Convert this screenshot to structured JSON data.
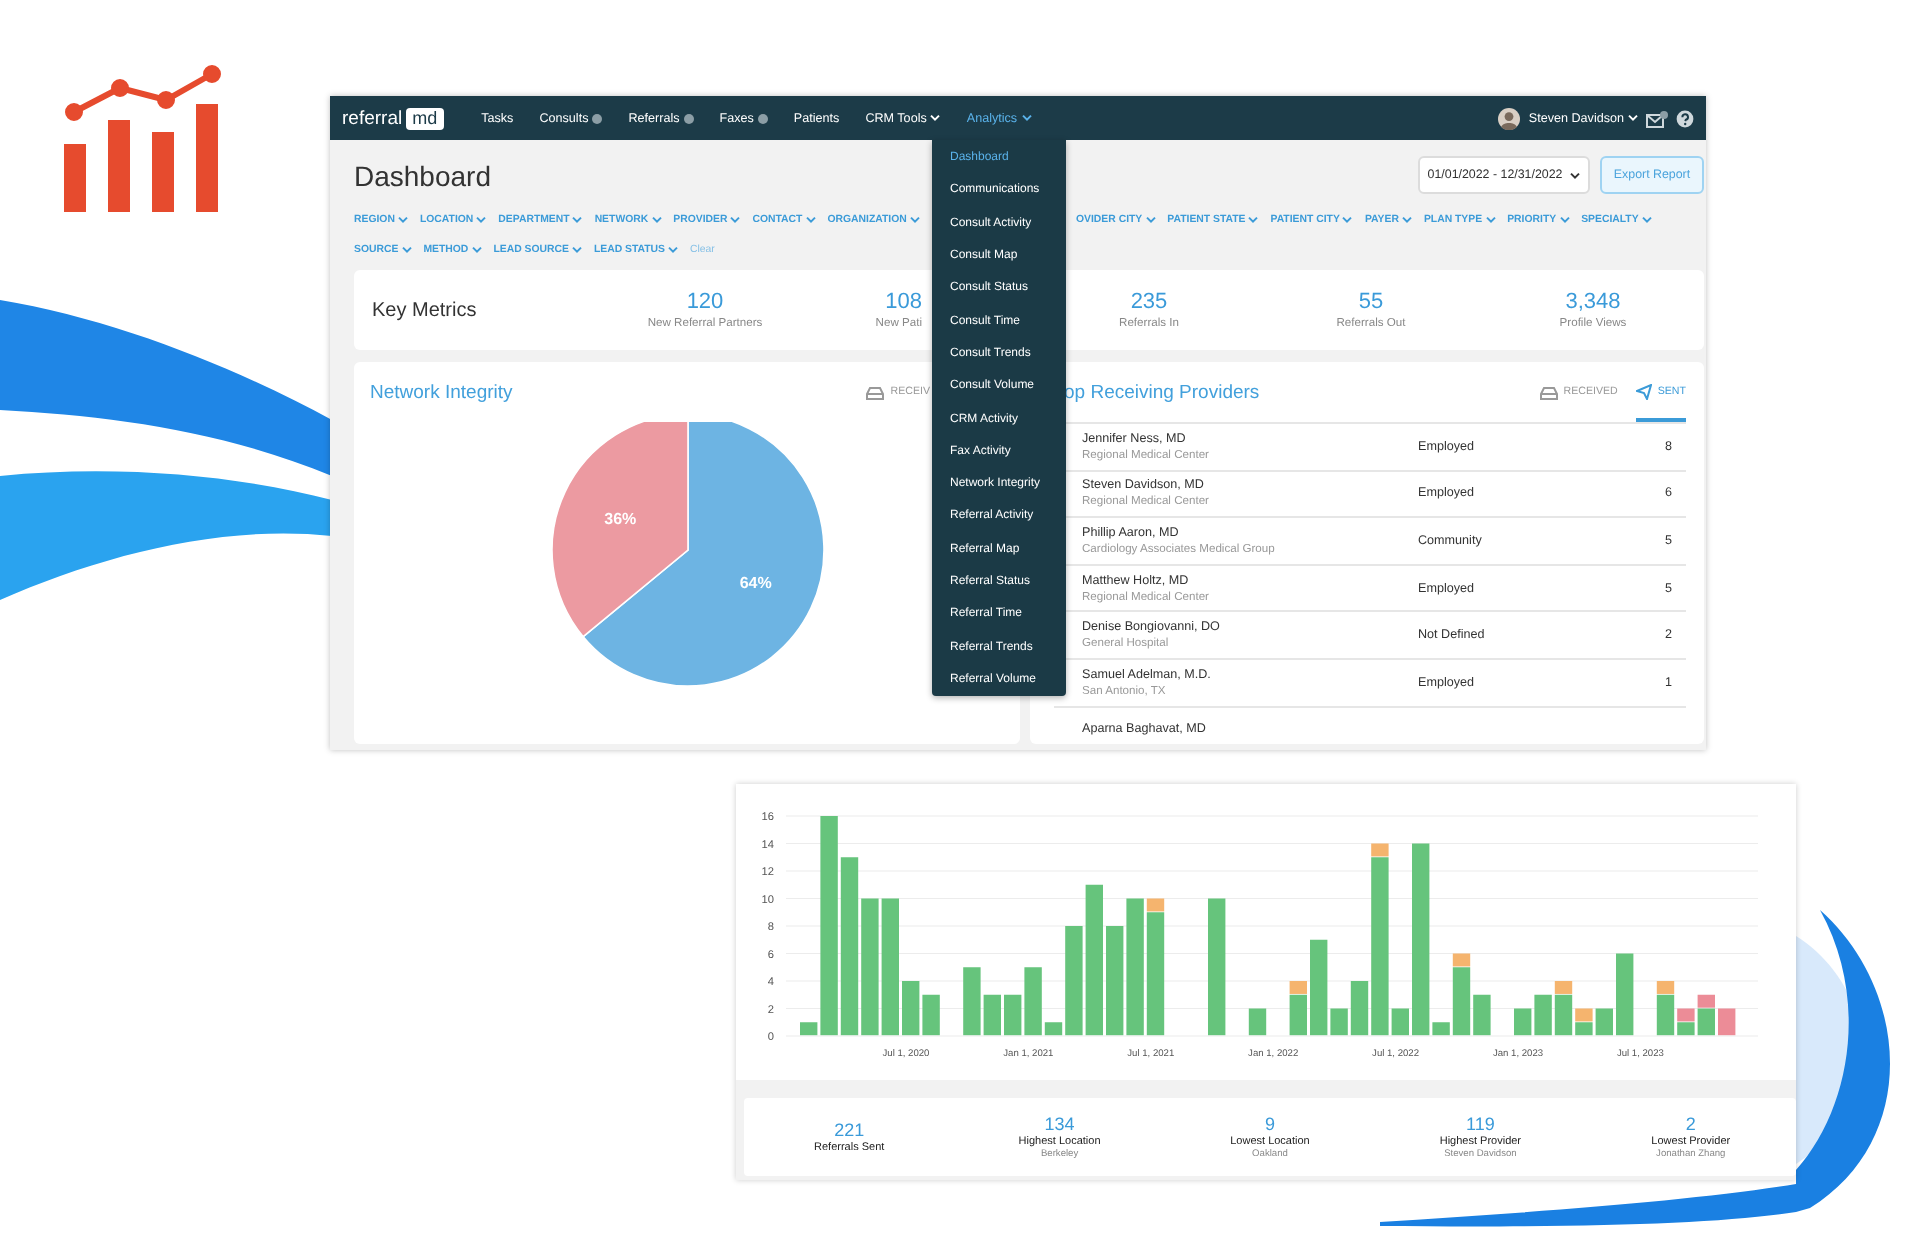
{
  "navbar": {
    "brand": "referral",
    "brand_badge": "md",
    "items": [
      {
        "label": "Tasks",
        "badge": false,
        "dropdown": false,
        "selected": false
      },
      {
        "label": "Consults",
        "badge": true,
        "dropdown": false,
        "selected": false
      },
      {
        "label": "Referrals",
        "badge": true,
        "dropdown": false,
        "selected": false
      },
      {
        "label": "Faxes",
        "badge": true,
        "dropdown": false,
        "selected": false
      },
      {
        "label": "Patients",
        "badge": false,
        "dropdown": false,
        "selected": false
      },
      {
        "label": "CRM Tools",
        "badge": false,
        "dropdown": true,
        "selected": false
      },
      {
        "label": "Analytics",
        "badge": false,
        "dropdown": true,
        "selected": true
      }
    ],
    "user": "Steven Davidson"
  },
  "analytics_menu": [
    {
      "label": "Dashboard",
      "selected": true
    },
    {
      "label": "Communications",
      "selected": false
    },
    {
      "label": "Consult Activity",
      "selected": false
    },
    {
      "label": "Consult Map",
      "selected": false
    },
    {
      "label": "Consult Status",
      "selected": false
    },
    {
      "label": "Consult Time",
      "selected": false
    },
    {
      "label": "Consult Trends",
      "selected": false
    },
    {
      "label": "Consult Volume",
      "selected": false
    },
    {
      "label": "CRM Activity",
      "selected": false
    },
    {
      "label": "Fax Activity",
      "selected": false
    },
    {
      "label": "Network Integrity",
      "selected": false
    },
    {
      "label": "Referral Activity",
      "selected": false
    },
    {
      "label": "Referral Map",
      "selected": false
    },
    {
      "label": "Referral Status",
      "selected": false
    },
    {
      "label": "Referral Time",
      "selected": false
    },
    {
      "label": "Referral Trends",
      "selected": false
    },
    {
      "label": "Referral Volume",
      "selected": false
    }
  ],
  "header": {
    "title": "Dashboard",
    "date_range": "01/01/2022 - 12/31/2022",
    "export_button": "Export Report"
  },
  "filters": [
    {
      "items": [
        {
          "label": "REGION",
          "kind": "filter"
        },
        {
          "label": "LOCATION",
          "kind": "filter"
        },
        {
          "label": "DEPARTMENT",
          "kind": "filter"
        },
        {
          "label": "NETWORK",
          "kind": "filter"
        },
        {
          "label": "PROVIDER",
          "kind": "filter"
        },
        {
          "label": "CONTACT",
          "kind": "filter"
        },
        {
          "label": "ORGANIZATION",
          "kind": "filter"
        }
      ],
      "items_after_menu": [
        {
          "label": "OVIDER CITY",
          "kind": "filter"
        },
        {
          "label": "PATIENT STATE",
          "kind": "filter"
        },
        {
          "label": "PATIENT CITY",
          "kind": "filter"
        },
        {
          "label": "PAYER",
          "kind": "filter"
        },
        {
          "label": "PLAN TYPE",
          "kind": "filter"
        },
        {
          "label": "PRIORITY",
          "kind": "filter"
        },
        {
          "label": "SPECIALTY",
          "kind": "filter"
        }
      ]
    },
    {
      "items": [
        {
          "label": "SOURCE",
          "kind": "filter"
        },
        {
          "label": "METHOD",
          "kind": "filter"
        },
        {
          "label": "LEAD SOURCE",
          "kind": "filter"
        },
        {
          "label": "LEAD STATUS",
          "kind": "filter"
        },
        {
          "label": "Clear",
          "kind": "link"
        }
      ]
    }
  ],
  "key_metrics": {
    "title": "Key Metrics",
    "metrics": [
      {
        "value": "120",
        "label": "New Referral Partners",
        "cut_by_menu": false
      },
      {
        "value": "108",
        "label": "New Pati",
        "cut_by_menu": true
      },
      {
        "value": "235",
        "label": "Referrals In",
        "cut_by_menu": false
      },
      {
        "value": "55",
        "label": "Referrals Out",
        "cut_by_menu": false
      },
      {
        "value": "3,348",
        "label": "Profile Views",
        "cut_by_menu": false
      }
    ]
  },
  "network_integrity": {
    "title": "Network Integrity",
    "toggle": "RECEIV",
    "chart_data": {
      "type": "pie",
      "values": [
        64,
        36
      ],
      "value_labels": [
        "64%",
        "36%"
      ]
    }
  },
  "top_providers": {
    "title": "op Receiving Providers",
    "tabs": [
      {
        "label": "RECEIVED",
        "selected": false
      },
      {
        "label": "SENT",
        "selected": true
      }
    ],
    "rows": [
      {
        "name": "Jennifer Ness, MD",
        "org": "Regional Medical Center",
        "status": "Employed",
        "count": "8"
      },
      {
        "name": "Steven Davidson, MD",
        "org": "Regional Medical Center",
        "status": "Employed",
        "count": "6"
      },
      {
        "name": "Phillip Aaron, MD",
        "org": "Cardiology Associates Medical Group",
        "status": "Community",
        "count": "5"
      },
      {
        "name": "Matthew Holtz, MD",
        "org": "Regional Medical Center",
        "status": "Employed",
        "count": "5"
      },
      {
        "name": "Denise Bongiovanni, DO",
        "org": "General Hospital",
        "status": "Not Defined",
        "count": "2"
      },
      {
        "name": "Samuel Adelman, M.D.",
        "org": "San Antonio, TX",
        "status": "Employed",
        "count": "1"
      },
      {
        "name": "Aparna Baghavat, MD"
      }
    ]
  },
  "trend_chart": {
    "chart_data": {
      "type": "bar",
      "stacked": true,
      "categories": [
        null,
        null,
        null,
        null,
        null,
        "Jul 1, 2020",
        null,
        null,
        null,
        null,
        null,
        "Jan 1, 2021",
        null,
        null,
        null,
        null,
        null,
        "Jul 1, 2021",
        null,
        null,
        null,
        null,
        null,
        "Jan 1, 2022",
        null,
        null,
        null,
        null,
        null,
        "Jul 1, 2022",
        null,
        null,
        null,
        null,
        null,
        "Jan 1, 2023",
        null,
        null,
        null,
        null,
        null,
        "Jul 1, 2023",
        null,
        null,
        null,
        null
      ],
      "series": [
        {
          "color": "#66c47c",
          "values": [
            1,
            16,
            13,
            10,
            10,
            4,
            3,
            0,
            5,
            3,
            3,
            5,
            1,
            8,
            11,
            8,
            10,
            9,
            0,
            0,
            10,
            0,
            2,
            0,
            3,
            7,
            2,
            4,
            13,
            2,
            14,
            1,
            5,
            3,
            0,
            2,
            3,
            3,
            1,
            2,
            6,
            0,
            3,
            1,
            2,
            0
          ]
        },
        {
          "color": "#f5b46e",
          "values": [
            0,
            0,
            0,
            0,
            0,
            0,
            0,
            0,
            0,
            0,
            0,
            0,
            0,
            0,
            0,
            0,
            0,
            1,
            0,
            0,
            0,
            0,
            0,
            0,
            1,
            0,
            0,
            0,
            1,
            0,
            0,
            0,
            1,
            0,
            0,
            0,
            0,
            1,
            1,
            0,
            0,
            0,
            1,
            0,
            0,
            0
          ]
        },
        {
          "color": "#ec8c97",
          "values": [
            0,
            0,
            0,
            0,
            0,
            0,
            0,
            0,
            0,
            0,
            0,
            0,
            0,
            0,
            0,
            0,
            0,
            0,
            0,
            0,
            0,
            0,
            0,
            0,
            0,
            0,
            0,
            0,
            0,
            0,
            0,
            0,
            0,
            0,
            0,
            0,
            0,
            0,
            0,
            0,
            0,
            0,
            0,
            1,
            1,
            2
          ]
        }
      ],
      "ylim": [
        0,
        16
      ],
      "grid": true,
      "yticks": [
        0,
        2,
        4,
        6,
        8,
        10,
        12,
        14,
        16
      ]
    }
  },
  "summary": [
    {
      "value": "221",
      "label": "Referrals Sent"
    },
    {
      "value": "134",
      "label": "Highest Location",
      "detail": "Berkeley"
    },
    {
      "value": "9",
      "label": "Lowest Location",
      "detail": "Oakland"
    },
    {
      "value": "119",
      "label": "Highest Provider",
      "detail": "Steven Davidson"
    },
    {
      "value": "2",
      "label": "Lowest Provider",
      "detail": "Jonathan Zhang"
    }
  ]
}
